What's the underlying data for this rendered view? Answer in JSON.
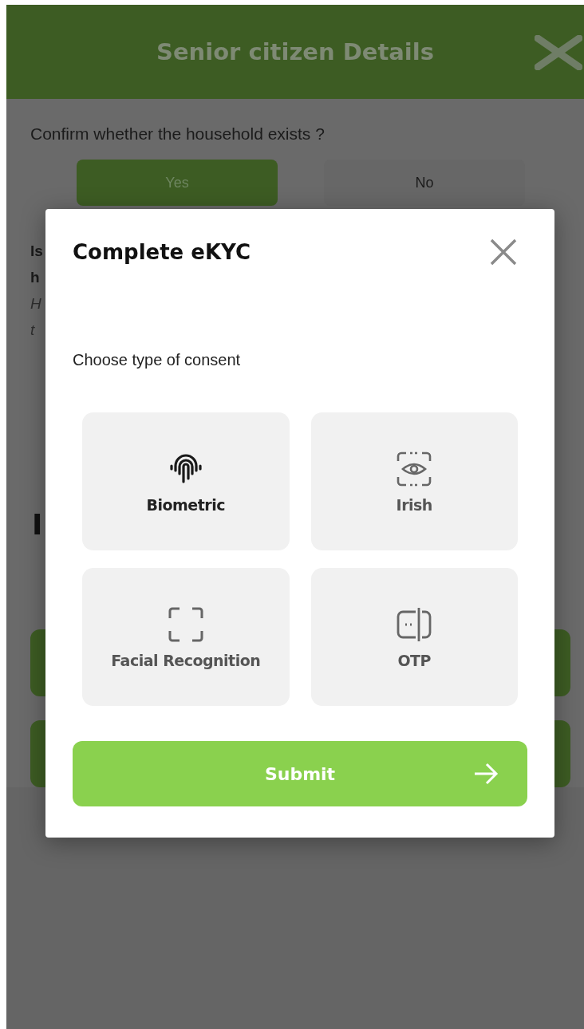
{
  "header": {
    "title": "Senior citizen Details"
  },
  "question": {
    "text": "Confirm whether the household exists ?",
    "options": [
      {
        "label": "Yes",
        "selected": true
      },
      {
        "label": "No",
        "selected": false
      }
    ]
  },
  "covered_fragments": [
    {
      "text": "Is",
      "kind": "plain"
    },
    {
      "text": "h",
      "kind": "plain"
    },
    {
      "text": "H",
      "kind": "italic"
    },
    {
      "text": "t",
      "kind": "italic"
    }
  ],
  "covered_heading": "I",
  "dialog": {
    "title": "Complete eKYC",
    "prompt": "Choose type of consent",
    "options": [
      {
        "label": "Biometric",
        "kind": "fingerprint"
      },
      {
        "label": "Irish",
        "kind": "eye"
      },
      {
        "label": "Facial Recognition",
        "kind": "face"
      },
      {
        "label": "OTP",
        "kind": "otp"
      }
    ],
    "submit": "Submit"
  }
}
